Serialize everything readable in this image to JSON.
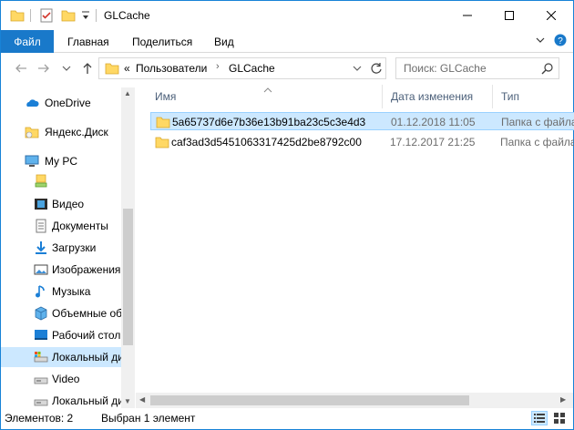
{
  "window": {
    "title": "GLCache"
  },
  "ribbon": {
    "tabs": [
      "Файл",
      "Главная",
      "Поделиться",
      "Вид"
    ]
  },
  "address": {
    "prefix": "«",
    "path": [
      "Пользователи",
      "GLCache"
    ]
  },
  "search": {
    "placeholder": "Поиск: GLCache"
  },
  "nav": {
    "items": [
      {
        "label": "OneDrive",
        "icon": "onedrive-icon"
      },
      {
        "label": "Яндекс.Диск",
        "icon": "yandex-disk-icon"
      },
      {
        "label": "My PC",
        "icon": "pc-icon"
      },
      {
        "label": "",
        "icon": "network-drive-icon"
      },
      {
        "label": "Видео",
        "icon": "video-folder-icon"
      },
      {
        "label": "Документы",
        "icon": "documents-folder-icon"
      },
      {
        "label": "Загрузки",
        "icon": "downloads-folder-icon"
      },
      {
        "label": "Изображения",
        "icon": "pictures-folder-icon"
      },
      {
        "label": "Музыка",
        "icon": "music-folder-icon"
      },
      {
        "label": "Объемные объекты",
        "icon": "3d-objects-folder-icon"
      },
      {
        "label": "Рабочий стол",
        "icon": "desktop-folder-icon"
      },
      {
        "label": "Локальный диск",
        "icon": "local-disk-icon"
      },
      {
        "label": "Video",
        "icon": "drive-icon"
      },
      {
        "label": "Локальный диск",
        "icon": "local-disk-icon"
      }
    ]
  },
  "columns": {
    "name": "Имя",
    "date": "Дата изменения",
    "type": "Тип"
  },
  "files": [
    {
      "name": "5a65737d6e7b36e13b91ba23c5c3e4d3",
      "date": "01.12.2018 11:05",
      "type": "Папка с файлами"
    },
    {
      "name": "caf3ad3d5451063317425d2be8792c00",
      "date": "17.12.2017 21:25",
      "type": "Папка с файлами"
    }
  ],
  "status": {
    "count": "Элементов: 2",
    "selected": "Выбран 1 элемент"
  },
  "colors": {
    "accent": "#1979ca",
    "selection": "#cce8ff",
    "folder": "#ffd864"
  }
}
